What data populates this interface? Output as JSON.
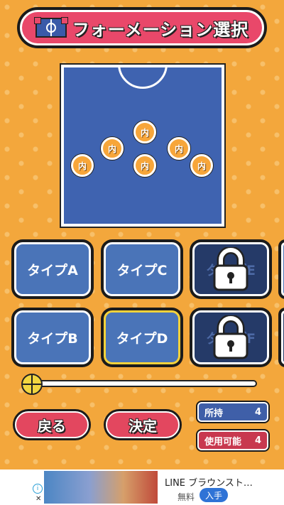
{
  "header": {
    "title": "フォーメーション選択",
    "icon": "field-icon"
  },
  "formation": {
    "players": [
      {
        "label": "内"
      },
      {
        "label": "内"
      },
      {
        "label": "内"
      },
      {
        "label": "内"
      },
      {
        "label": "内"
      },
      {
        "label": "内"
      }
    ]
  },
  "types": [
    {
      "label": "タイプA",
      "locked": false
    },
    {
      "label": "タイプC",
      "locked": false
    },
    {
      "label": "タイプE",
      "locked": true
    },
    {
      "label": "タイプB",
      "locked": false
    },
    {
      "label": "タイプD",
      "locked": false,
      "selected": true
    },
    {
      "label": "タイプF",
      "locked": true
    }
  ],
  "buttons": {
    "back": "戻る",
    "confirm": "決定"
  },
  "stats": {
    "owned_label": "所持",
    "owned_value": "4",
    "available_label": "使用可能",
    "available_value": "4"
  },
  "ad": {
    "title": "LINE ブラウンスト…",
    "price": "無料",
    "install": "入手",
    "info_icon": "i",
    "close_icon": "✕"
  },
  "colors": {
    "background": "#f3a73c",
    "banner": "#e9486a",
    "pitch": "#3f63b0",
    "selected_border": "#f6d23a"
  }
}
